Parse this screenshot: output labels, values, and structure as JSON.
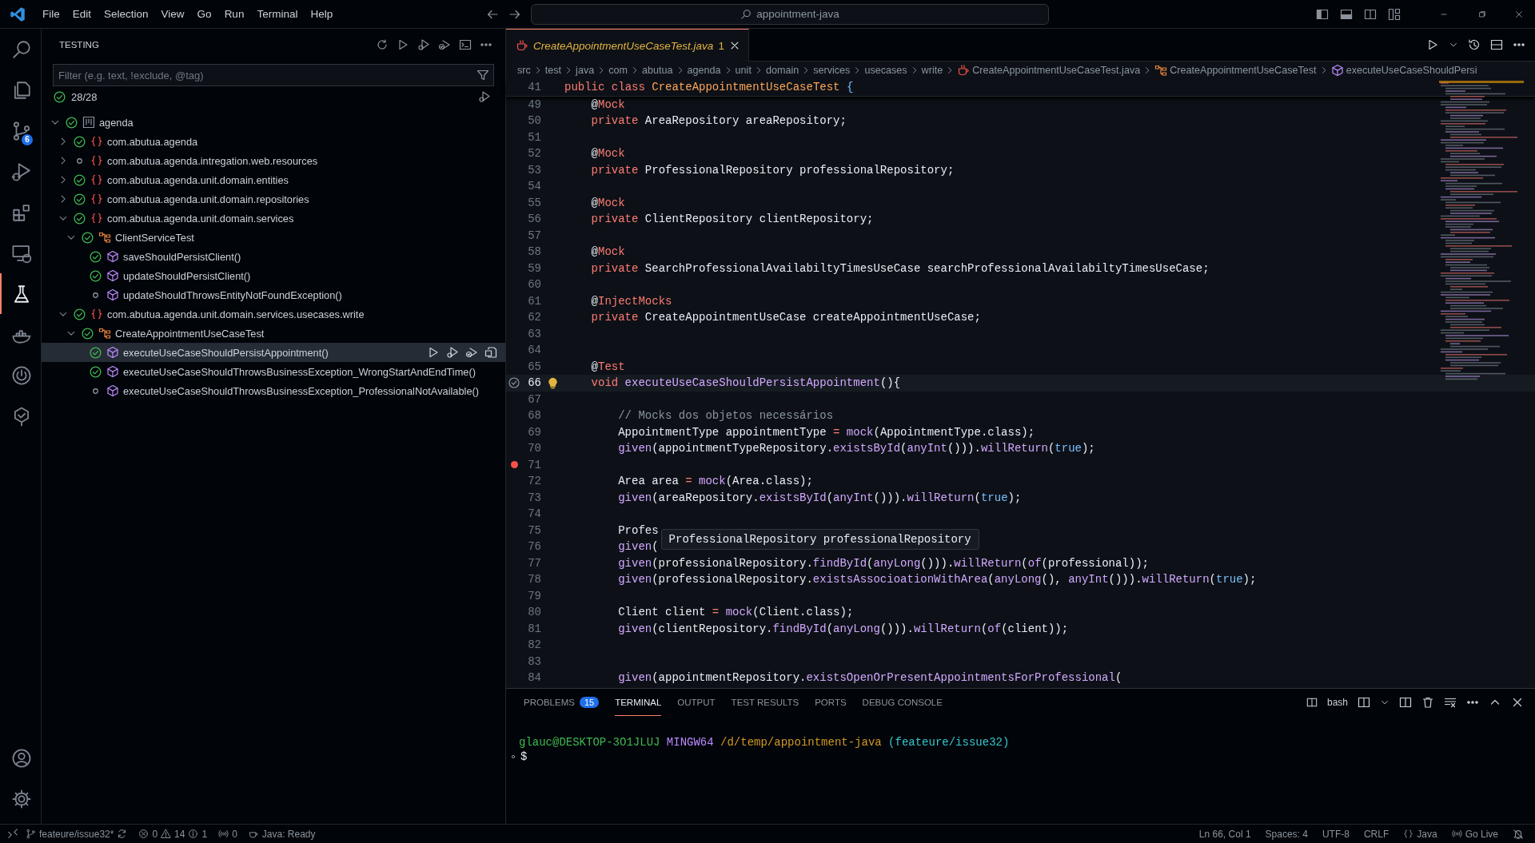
{
  "title_bar": {
    "menu": [
      "File",
      "Edit",
      "Selection",
      "View",
      "Go",
      "Run",
      "Terminal",
      "Help"
    ],
    "search": "appointment-java"
  },
  "activity_bar": {
    "items": [
      {
        "kind": "search",
        "selected": false
      },
      {
        "kind": "explorer",
        "selected": false
      },
      {
        "kind": "source-control",
        "selected": false,
        "badge": "6"
      },
      {
        "kind": "run-debug",
        "selected": false
      },
      {
        "kind": "extensions",
        "selected": false
      },
      {
        "kind": "remote",
        "selected": false
      },
      {
        "kind": "testing",
        "selected": true
      },
      {
        "kind": "docker",
        "selected": false
      },
      {
        "kind": "power",
        "selected": false
      },
      {
        "kind": "check-balloon",
        "selected": false
      }
    ],
    "bottom": [
      {
        "kind": "account"
      },
      {
        "kind": "settings"
      }
    ]
  },
  "sidebar": {
    "title": "TESTING",
    "filter": {
      "placeholder": "Filter (e.g. text, !exclude, @tag)"
    },
    "summary": "28/28",
    "tree": [
      {
        "label": "agenda",
        "kind": "workspace",
        "passed": true,
        "expanded": true,
        "selected": false,
        "children": [
          {
            "label": "com.abutua.agenda",
            "kind": "package",
            "passed": true,
            "expanded": false,
            "selected": false
          },
          {
            "label": "com.abutua.agenda.intregation.web.resources",
            "kind": "package",
            "passed": false,
            "expanded": false,
            "selected": false
          },
          {
            "label": "com.abutua.agenda.unit.domain.entities",
            "kind": "package",
            "passed": true,
            "expanded": false,
            "selected": false
          },
          {
            "label": "com.abutua.agenda.unit.domain.repositories",
            "kind": "package",
            "passed": true,
            "expanded": false,
            "selected": false
          },
          {
            "label": "com.abutua.agenda.unit.domain.services",
            "kind": "package",
            "passed": true,
            "expanded": true,
            "selected": false,
            "children": [
              {
                "label": "ClientServiceTest",
                "kind": "class",
                "passed": true,
                "expanded": true,
                "selected": false,
                "children": [
                  {
                    "label": "saveShouldPersistClient()",
                    "kind": "method",
                    "passed": true,
                    "selected": false
                  },
                  {
                    "label": "updateShouldPersistClient()",
                    "kind": "method",
                    "passed": true,
                    "selected": false
                  },
                  {
                    "label": "updateShouldThrowsEntityNotFoundException()",
                    "kind": "method",
                    "passed": false,
                    "selected": false
                  }
                ]
              }
            ]
          },
          {
            "label": "com.abutua.agenda.unit.domain.services.usecases.write",
            "kind": "package",
            "passed": true,
            "expanded": true,
            "selected": false,
            "children": [
              {
                "label": "CreateAppointmentUseCaseTest",
                "kind": "class",
                "passed": true,
                "expanded": true,
                "selected": false,
                "children": [
                  {
                    "label": "executeUseCaseShouldPersistAppointment()",
                    "kind": "method",
                    "passed": true,
                    "selected": true
                  },
                  {
                    "label": "executeUseCaseShouldThrowsBusinessException_WrongStartAndEndTime()",
                    "kind": "method",
                    "passed": true,
                    "selected": false
                  },
                  {
                    "label": "executeUseCaseShouldThrowsBusinessException_ProfessionalNotAvailable()",
                    "kind": "method",
                    "passed": false,
                    "selected": false
                  }
                ]
              }
            ]
          }
        ]
      }
    ]
  },
  "editor": {
    "tabs": [
      {
        "label": "CreateAppointmentUseCaseTest.java",
        "problems": "1",
        "selected": true
      }
    ],
    "breadcrumb": [
      {
        "label": "src",
        "kind": "folder"
      },
      {
        "label": "test",
        "kind": "folder"
      },
      {
        "label": "java",
        "kind": "folder"
      },
      {
        "label": "com",
        "kind": "folder"
      },
      {
        "label": "abutua",
        "kind": "folder"
      },
      {
        "label": "agenda",
        "kind": "folder"
      },
      {
        "label": "unit",
        "kind": "folder"
      },
      {
        "label": "domain",
        "kind": "folder"
      },
      {
        "label": "services",
        "kind": "folder"
      },
      {
        "label": "usecases",
        "kind": "folder"
      },
      {
        "label": "write",
        "kind": "folder"
      },
      {
        "label": "CreateAppointmentUseCaseTest.java",
        "kind": "file"
      },
      {
        "label": "CreateAppointmentUseCaseTest",
        "kind": "class"
      },
      {
        "label": "executeUseCaseShouldPersi",
        "kind": "method"
      }
    ],
    "sticky_line": {
      "number": "41",
      "tokens": [
        {
          "kind": "keyword",
          "text": "public"
        },
        {
          "kind": "keyword",
          "text": " class"
        },
        {
          "kind": "class",
          "text": " CreateAppointmentUseCaseTest"
        },
        {
          "kind": "literal",
          "text": " {"
        }
      ]
    },
    "lines": [
      {
        "number": "49",
        "current": false,
        "tokens": [
          {
            "kind": "plain",
            "text": "    @"
          },
          {
            "kind": "keyword",
            "text": "Mock"
          }
        ]
      },
      {
        "number": "50",
        "current": false,
        "tokens": [
          {
            "kind": "keyword",
            "text": "    private"
          },
          {
            "kind": "plain",
            "text": " AreaRepository areaRepository;"
          }
        ]
      },
      {
        "number": "51",
        "current": false
      },
      {
        "number": "52",
        "current": false,
        "tokens": [
          {
            "kind": "plain",
            "text": "    @"
          },
          {
            "kind": "keyword",
            "text": "Mock"
          }
        ]
      },
      {
        "number": "53",
        "current": false,
        "tokens": [
          {
            "kind": "keyword",
            "text": "    private"
          },
          {
            "kind": "plain",
            "text": " ProfessionalRepository professionalRepository;"
          }
        ]
      },
      {
        "number": "54",
        "current": false
      },
      {
        "number": "55",
        "current": false,
        "tokens": [
          {
            "kind": "plain",
            "text": "    @"
          },
          {
            "kind": "keyword",
            "text": "Mock"
          }
        ]
      },
      {
        "number": "56",
        "current": false,
        "tokens": [
          {
            "kind": "keyword",
            "text": "    private"
          },
          {
            "kind": "plain",
            "text": " ClientRepository clientRepository;"
          }
        ]
      },
      {
        "number": "57",
        "current": false
      },
      {
        "number": "58",
        "current": false,
        "tokens": [
          {
            "kind": "plain",
            "text": "    @"
          },
          {
            "kind": "keyword",
            "text": "Mock"
          }
        ]
      },
      {
        "number": "59",
        "current": false,
        "tokens": [
          {
            "kind": "keyword",
            "text": "    private"
          },
          {
            "kind": "plain",
            "text": " SearchProfessionalAvailabiltyTimesUseCase searchProfessionalAvailabiltyTimesUseCase;"
          }
        ]
      },
      {
        "number": "60",
        "current": false
      },
      {
        "number": "61",
        "current": false,
        "tokens": [
          {
            "kind": "plain",
            "text": "    @"
          },
          {
            "kind": "keyword",
            "text": "InjectMocks"
          }
        ]
      },
      {
        "number": "62",
        "current": false,
        "tokens": [
          {
            "kind": "keyword",
            "text": "    private"
          },
          {
            "kind": "plain",
            "text": " CreateAppointmentUseCase createAppointmentUseCase;"
          }
        ]
      },
      {
        "number": "63",
        "current": false
      },
      {
        "number": "64",
        "current": false
      },
      {
        "number": "65",
        "current": false,
        "tokens": [
          {
            "kind": "plain",
            "text": "    @"
          },
          {
            "kind": "keyword",
            "text": "Test"
          }
        ]
      },
      {
        "number": "66",
        "current": true,
        "test_passed": true,
        "lightbulb": true,
        "tokens": [
          {
            "kind": "keyword",
            "text": "    void"
          },
          {
            "kind": "function",
            "text": " executeUseCaseShouldPersistAppointment"
          },
          {
            "kind": "plain",
            "text": "(){"
          }
        ]
      },
      {
        "number": "67",
        "current": false
      },
      {
        "number": "68",
        "current": false,
        "tokens": [
          {
            "kind": "comment",
            "text": "        // Mocks dos objetos necessários"
          }
        ]
      },
      {
        "number": "69",
        "current": false,
        "tokens": [
          {
            "kind": "plain",
            "text": "        AppointmentType appointmentType "
          },
          {
            "kind": "keyword",
            "text": "="
          },
          {
            "kind": "function",
            "text": " mock"
          },
          {
            "kind": "plain",
            "text": "(AppointmentType.class);"
          }
        ]
      },
      {
        "number": "70",
        "current": false,
        "tokens": [
          {
            "kind": "function",
            "text": "        given"
          },
          {
            "kind": "plain",
            "text": "(appointmentTypeRepository."
          },
          {
            "kind": "function",
            "text": "existsById"
          },
          {
            "kind": "plain",
            "text": "("
          },
          {
            "kind": "function",
            "text": "anyInt"
          },
          {
            "kind": "plain",
            "text": "()))."
          },
          {
            "kind": "function",
            "text": "willReturn"
          },
          {
            "kind": "plain",
            "text": "("
          },
          {
            "kind": "literal",
            "text": "true"
          },
          {
            "kind": "plain",
            "text": ");"
          }
        ]
      },
      {
        "number": "71",
        "current": false,
        "breakpoint": true
      },
      {
        "number": "72",
        "current": false,
        "tokens": [
          {
            "kind": "plain",
            "text": "        Area area "
          },
          {
            "kind": "keyword",
            "text": "="
          },
          {
            "kind": "function",
            "text": " mock"
          },
          {
            "kind": "plain",
            "text": "(Area.class);"
          }
        ]
      },
      {
        "number": "73",
        "current": false,
        "tokens": [
          {
            "kind": "function",
            "text": "        given"
          },
          {
            "kind": "plain",
            "text": "(areaRepository."
          },
          {
            "kind": "function",
            "text": "existsById"
          },
          {
            "kind": "plain",
            "text": "("
          },
          {
            "kind": "function",
            "text": "anyInt"
          },
          {
            "kind": "plain",
            "text": "()))."
          },
          {
            "kind": "function",
            "text": "willReturn"
          },
          {
            "kind": "plain",
            "text": "("
          },
          {
            "kind": "literal",
            "text": "true"
          },
          {
            "kind": "plain",
            "text": ");"
          }
        ]
      },
      {
        "number": "74",
        "current": false
      },
      {
        "number": "75",
        "current": false,
        "tokens": [
          {
            "kind": "plain",
            "text": "        Profes"
          }
        ]
      },
      {
        "number": "76",
        "current": false,
        "tokens": [
          {
            "kind": "function",
            "text": "        given"
          },
          {
            "kind": "plain",
            "text": "("
          }
        ]
      },
      {
        "number": "77",
        "current": false,
        "tokens": [
          {
            "kind": "function",
            "text": "        given"
          },
          {
            "kind": "plain",
            "text": "(professionalRepository."
          },
          {
            "kind": "function",
            "text": "findById"
          },
          {
            "kind": "plain",
            "text": "("
          },
          {
            "kind": "function",
            "text": "anyLong"
          },
          {
            "kind": "plain",
            "text": "()))."
          },
          {
            "kind": "function",
            "text": "willReturn"
          },
          {
            "kind": "plain",
            "text": "("
          },
          {
            "kind": "function",
            "text": "of"
          },
          {
            "kind": "plain",
            "text": "(professional));"
          }
        ]
      },
      {
        "number": "78",
        "current": false,
        "tokens": [
          {
            "kind": "function",
            "text": "        given"
          },
          {
            "kind": "plain",
            "text": "(professionalRepository."
          },
          {
            "kind": "function",
            "text": "existsAssocioationWithArea"
          },
          {
            "kind": "plain",
            "text": "("
          },
          {
            "kind": "function",
            "text": "anyLong"
          },
          {
            "kind": "plain",
            "text": "(), "
          },
          {
            "kind": "function",
            "text": "anyInt"
          },
          {
            "kind": "plain",
            "text": "()))."
          },
          {
            "kind": "function",
            "text": "willReturn"
          },
          {
            "kind": "plain",
            "text": "("
          },
          {
            "kind": "literal",
            "text": "true"
          },
          {
            "kind": "plain",
            "text": ");"
          }
        ]
      },
      {
        "number": "79",
        "current": false
      },
      {
        "number": "80",
        "current": false,
        "tokens": [
          {
            "kind": "plain",
            "text": "        Client client "
          },
          {
            "kind": "keyword",
            "text": "="
          },
          {
            "kind": "function",
            "text": " mock"
          },
          {
            "kind": "plain",
            "text": "(Client.class);"
          }
        ]
      },
      {
        "number": "81",
        "current": false,
        "tokens": [
          {
            "kind": "function",
            "text": "        given"
          },
          {
            "kind": "plain",
            "text": "(clientRepository."
          },
          {
            "kind": "function",
            "text": "findById"
          },
          {
            "kind": "plain",
            "text": "("
          },
          {
            "kind": "function",
            "text": "anyLong"
          },
          {
            "kind": "plain",
            "text": "()))."
          },
          {
            "kind": "function",
            "text": "willReturn"
          },
          {
            "kind": "plain",
            "text": "("
          },
          {
            "kind": "function",
            "text": "of"
          },
          {
            "kind": "plain",
            "text": "(client));"
          }
        ]
      },
      {
        "number": "82",
        "current": false
      },
      {
        "number": "83",
        "current": false
      },
      {
        "number": "84",
        "current": false,
        "tokens": [
          {
            "kind": "function",
            "text": "        given"
          },
          {
            "kind": "plain",
            "text": "(appointmentRepository."
          },
          {
            "kind": "function",
            "text": "existsOpenOrPresentAppointmentsForProfessional"
          },
          {
            "kind": "plain",
            "text": "("
          }
        ]
      }
    ],
    "hover": {
      "text": "ProfessionalRepository professionalRepository"
    }
  },
  "panel": {
    "tabs": [
      {
        "label": "PROBLEMS",
        "badge": "15",
        "selected": false
      },
      {
        "label": "TERMINAL",
        "selected": true
      },
      {
        "label": "OUTPUT",
        "selected": false
      },
      {
        "label": "TEST RESULTS",
        "selected": false
      },
      {
        "label": "PORTS",
        "selected": false
      },
      {
        "label": "DEBUG CONSOLE",
        "selected": false
      }
    ],
    "shell": "bash",
    "terminal": {
      "prompt": [
        {
          "kind": "user",
          "text": "glauc@DESKTOP-3O1JLUJ"
        },
        {
          "kind": "system",
          "text": "MINGW64"
        },
        {
          "kind": "path",
          "text": "/d/temp/appointment-java"
        },
        {
          "kind": "branch",
          "text": "(feateure/issue32)"
        }
      ],
      "input": "$"
    }
  },
  "status_bar": {
    "branch": "feateure/issue32*",
    "errors": "0",
    "warnings": "14",
    "infos": "1",
    "ports": "0",
    "java": "Java: Ready",
    "position": "Ln 66, Col 1",
    "indent": "Spaces: 4",
    "encoding": "UTF-8",
    "eol": "CRLF",
    "language": "Java",
    "live": "Go Live"
  }
}
